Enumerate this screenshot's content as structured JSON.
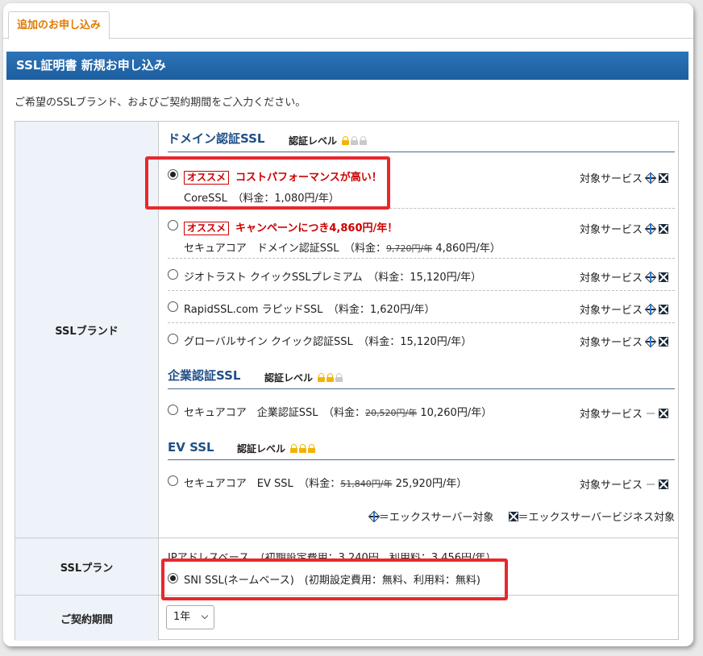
{
  "tab": {
    "label": "追加のお申し込み"
  },
  "header": {
    "title": "SSL証明書 新規お申し込み"
  },
  "intro": "ご希望のSSLブランド、およびご契約期間をご入力ください。",
  "labels": {
    "brand": "SSLブランド",
    "plan": "SSLプラン",
    "period": "ご契約期間"
  },
  "groups": [
    {
      "name": "ドメイン認証SSL",
      "level_label": "認証レベル",
      "level": 1
    },
    {
      "name": "企業認証SSL",
      "level_label": "認証レベル",
      "level": 2
    },
    {
      "name": "EV SSL",
      "level_label": "認証レベル",
      "level": 3
    }
  ],
  "options": [
    {
      "badge": "オススメ",
      "promo": "コストパフォーマンスが高い！",
      "line2": "CoreSSL　（料金：1,080円/年）",
      "service_label": "対象サービス",
      "selected": true
    },
    {
      "badge": "オススメ",
      "promo": "キャンペーンにつき4,860円/年！",
      "line2_prefix": "セキュアコア　ドメイン認証SSL　（料金：",
      "old_price": "9,720円/年",
      "line2_suffix": " 4,860円/年）",
      "service_label": "対象サービス",
      "selected": false
    },
    {
      "text": "ジオトラスト クイックSSLプレミアム　（料金：15,120円/年）",
      "service_label": "対象サービス",
      "selected": false
    },
    {
      "text": "RapidSSL.com ラピッドSSL　（料金：1,620円/年）",
      "service_label": "対象サービス",
      "selected": false
    },
    {
      "text": "グローバルサイン クイック認証SSL　（料金：15,120円/年）",
      "service_label": "対象サービス",
      "selected": false
    },
    {
      "prefix": "セキュアコア　企業認証SSL　（料金：",
      "old_price": "20,520円/年",
      "suffix": " 10,260円/年）",
      "service_label": "対象サービス",
      "selected": false
    },
    {
      "prefix": "セキュアコア　EV SSL　（料金：",
      "old_price": "51,840円/年",
      "suffix": " 25,920円/年）",
      "service_label": "対象サービス",
      "selected": false
    }
  ],
  "legend": {
    "xserver": "＝エックスサーバー対象",
    "business": "＝エックスサーバービジネス対象"
  },
  "plan": {
    "clipped_text": "IPアドレスベース　（初期設定費用：3,240円、利用料：3,456円/年）",
    "selected_text": "SNI SSL(ネームベース)　(初期設定費用：無料、利用料：無料)"
  },
  "period": {
    "value": "1年"
  },
  "colors": {
    "header": "#2b74b8",
    "tab_text": "#e07a00",
    "highlight": "#e8282c",
    "promo": "#cc0000"
  }
}
